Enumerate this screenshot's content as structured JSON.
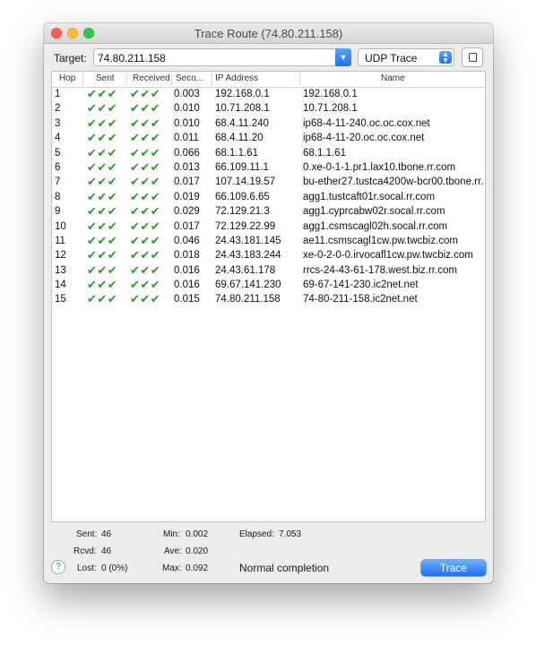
{
  "window": {
    "title": "Trace Route (74.80.211.158)"
  },
  "toolbar": {
    "target_label": "Target:",
    "target_value": "74.80.211.158",
    "mode_value": "UDP Trace"
  },
  "table": {
    "columns": [
      "Hop",
      "Sent",
      "Received",
      "Seco...",
      "IP Address",
      "Name"
    ],
    "rows": [
      {
        "hop": "1",
        "sent": "✔✔✔",
        "received": "✔✔✔",
        "seconds": "0.003",
        "ip": "192.168.0.1",
        "name": "192.168.0.1"
      },
      {
        "hop": "2",
        "sent": "✔✔✔",
        "received": "✔✔✔",
        "seconds": "0.010",
        "ip": "10.71.208.1",
        "name": "10.71.208.1"
      },
      {
        "hop": "3",
        "sent": "✔✔✔",
        "received": "✔✔✔",
        "seconds": "0.010",
        "ip": "68.4.11.240",
        "name": "ip68-4-11-240.oc.oc.cox.net"
      },
      {
        "hop": "4",
        "sent": "✔✔✔",
        "received": "✔✔✔",
        "seconds": "0.011",
        "ip": "68.4.11.20",
        "name": "ip68-4-11-20.oc.oc.cox.net"
      },
      {
        "hop": "5",
        "sent": "✔✔✔",
        "received": "✔✔✔",
        "seconds": "0.066",
        "ip": "68.1.1.61",
        "name": "68.1.1.61"
      },
      {
        "hop": "6",
        "sent": "✔✔✔",
        "received": "✔✔✔",
        "seconds": "0.013",
        "ip": "66.109.11.1",
        "name": "0.xe-0-1-1.pr1.lax10.tbone.rr.com"
      },
      {
        "hop": "7",
        "sent": "✔✔✔",
        "received": "✔✔✔",
        "seconds": "0.017",
        "ip": "107.14.19.57",
        "name": "bu-ether27.tustca4200w-bcr00.tbone.rr."
      },
      {
        "hop": "8",
        "sent": "✔✔✔",
        "received": "✔✔✔",
        "seconds": "0.019",
        "ip": "66.109.6.65",
        "name": "agg1.tustcaft01r.socal.rr.com"
      },
      {
        "hop": "9",
        "sent": "✔✔✔",
        "received": "✔✔✔",
        "seconds": "0.029",
        "ip": "72.129.21.3",
        "name": "agg1.cyprcabw02r.socal.rr.com"
      },
      {
        "hop": "10",
        "sent": "✔✔✔",
        "received": "✔✔✔",
        "seconds": "0.017",
        "ip": "72.129.22.99",
        "name": "agg1.csmscagl02h.socal.rr.com"
      },
      {
        "hop": "11",
        "sent": "✔✔✔",
        "received": "✔✔✔",
        "seconds": "0.046",
        "ip": "24.43.181.145",
        "name": "ae11.csmscagl1cw.pw.twcbiz.com"
      },
      {
        "hop": "12",
        "sent": "✔✔✔",
        "received": "✔✔✔",
        "seconds": "0.018",
        "ip": "24.43.183.244",
        "name": "xe-0-2-0-0.irvocafl1cw.pw.twcbiz.com"
      },
      {
        "hop": "13",
        "sent": "✔✔✔",
        "received": "✔✔✔",
        "seconds": "0.016",
        "ip": "24.43.61.178",
        "name": "rrcs-24-43-61-178.west.biz.rr.com"
      },
      {
        "hop": "14",
        "sent": "✔✔✔",
        "received": "✔✔✔",
        "seconds": "0.016",
        "ip": "69.67.141.230",
        "name": "69-67-141-230.ic2net.net"
      },
      {
        "hop": "15",
        "sent": "✔✔✔",
        "received": "✔✔✔",
        "seconds": "0.015",
        "ip": "74.80.211.158",
        "name": "74-80-211-158.ic2net.net"
      }
    ]
  },
  "stats": {
    "sent_label": "Sent:",
    "sent_value": "46",
    "rcvd_label": "Rcvd:",
    "rcvd_value": "46",
    "lost_label": "Lost:",
    "lost_value": "0 (0%)",
    "min_label": "Min:",
    "min_value": "0.002",
    "ave_label": "Ave:",
    "ave_value": "0.020",
    "max_label": "Max:",
    "max_value": "0.092",
    "elapsed_label": "Elapsed:",
    "elapsed_value": "7.053"
  },
  "footer": {
    "help_label": "?",
    "status": "Normal completion",
    "trace_button": "Trace"
  },
  "colors": {
    "check": "#2e9a2e",
    "accent": "#1f6ff0"
  },
  "icons": [
    "combo-chevron-icon",
    "select-updown-icon",
    "share-icon",
    "help-icon"
  ]
}
